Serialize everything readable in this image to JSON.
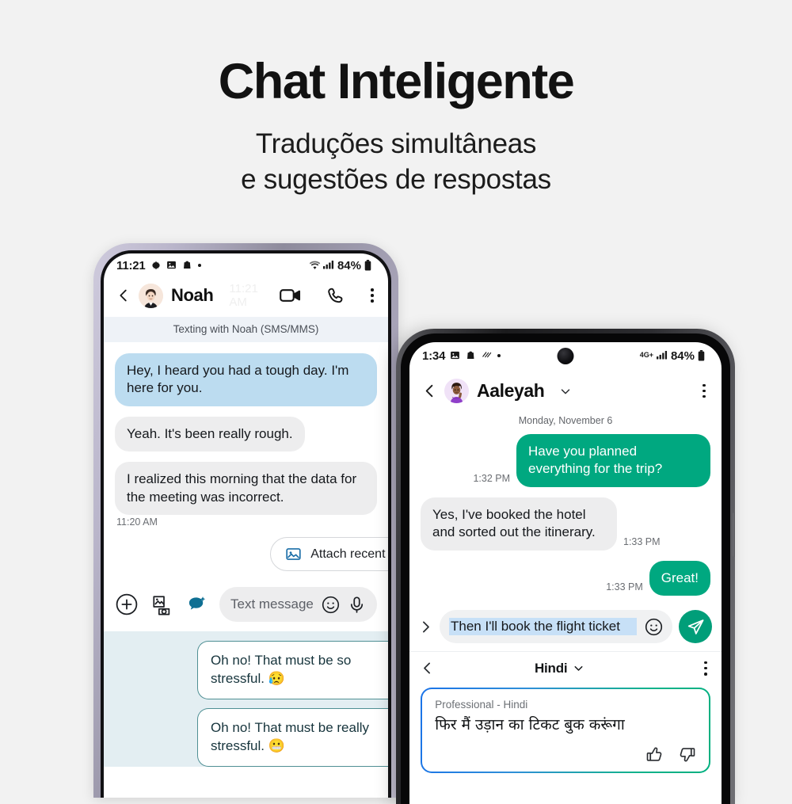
{
  "hero": {
    "title": "Chat Inteligente",
    "subtitle_line1": "Traduções simultâneas",
    "subtitle_line2": "e sugestões de respostas"
  },
  "phone_left": {
    "status_bar": {
      "time": "11:21",
      "icons": [
        "gear-icon",
        "photo-icon",
        "shopping-bag-icon",
        "dot-icon"
      ],
      "wifi": "wifi-icon",
      "signal": "signal-bars-icon",
      "battery_percent": "84%",
      "battery": "battery-icon"
    },
    "header": {
      "back": "chevron-left-icon",
      "avatar": "emoji-avatar-noah",
      "name": "Noah",
      "ghost_time": "11:21 AM",
      "video_call": "video-camera-icon",
      "voice_call": "phone-icon",
      "more": "kebab-menu-icon"
    },
    "sms_banner": "Texting with Noah (SMS/MMS)",
    "messages": [
      {
        "side": "out",
        "style": "blue",
        "text": "Hey, I heard you had a tough day. I'm here for you."
      },
      {
        "side": "in",
        "style": "gray",
        "text": "Yeah. It's been really rough."
      },
      {
        "side": "in",
        "style": "gray",
        "text": "I realized this morning that the data for the meeting was incorrect."
      }
    ],
    "timestamp": "11:20 AM",
    "suggestion_chip": {
      "icon": "image-attach-icon",
      "label": "Attach recent photo"
    },
    "input_bar": {
      "add": "plus-circle-icon",
      "gallery": "gallery-camera-icon",
      "ai_assist": "ai-chat-bubble-icon",
      "placeholder": "Text message",
      "emoji": "smiley-icon",
      "mic": "microphone-icon"
    },
    "ai_suggestions": [
      "Oh no! That must be so stressful. 😥",
      "Oh no! That must be really stressful. 😬"
    ]
  },
  "phone_right": {
    "status_bar": {
      "time": "1:34",
      "icons": [
        "photo-icon",
        "shopping-bag-icon",
        "mute-icon",
        "dot-icon"
      ],
      "network": "4G+",
      "signal": "signal-bars-icon",
      "battery_percent": "84%",
      "battery": "battery-icon"
    },
    "header": {
      "back": "chevron-left-icon",
      "avatar": "emoji-avatar-aaleyah",
      "name": "Aaleyah",
      "caret": "chevron-down-icon",
      "more": "kebab-menu-icon"
    },
    "date_banner": "Monday, November 6",
    "messages": [
      {
        "side": "out",
        "style": "green",
        "text": "Have you planned everything for the trip?",
        "time": "1:32 PM"
      },
      {
        "side": "in",
        "style": "gray",
        "text": "Yes, I've booked the hotel and sorted out the itinerary.",
        "time": "1:33 PM"
      },
      {
        "side": "out",
        "style": "green",
        "text": "Great!",
        "time": "1:33 PM"
      }
    ],
    "input_bar": {
      "expand": "chevron-right-icon",
      "value": "Then I'll book the flight ticket",
      "emoji": "smiley-icon",
      "send": "send-paper-plane-icon"
    },
    "language_bar": {
      "back": "chevron-left-icon",
      "language": "Hindi",
      "caret": "chevron-down-icon",
      "more": "kebab-menu-icon"
    },
    "translation_card": {
      "label": "Professional - Hindi",
      "text": "फिर मैं उड़ान का टिकट बुक करूंगा",
      "thumbs_up": "thumbs-up-icon",
      "thumbs_down": "thumbs-down-icon"
    }
  },
  "colors": {
    "background": "#f2f2f2",
    "accent_green": "#00a880",
    "bubble_blue": "#bcdcf0",
    "bubble_gray": "#ededee",
    "ai_panel": "#e3eef2",
    "selection_blue": "#c7e0f7"
  }
}
